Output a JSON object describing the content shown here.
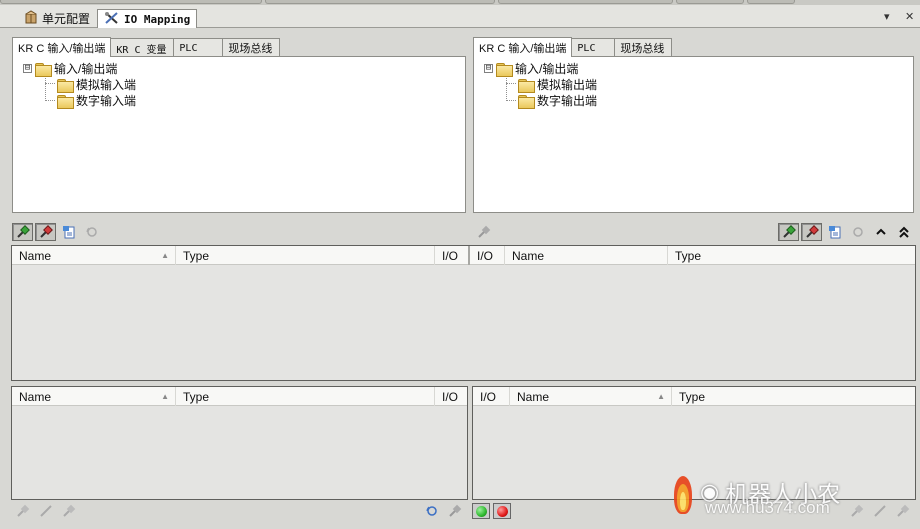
{
  "doc_tabs": [
    {
      "label": "单元配置",
      "icon": "cell-config-icon"
    },
    {
      "label": "IO Mapping",
      "icon": "io-mapping-icon"
    }
  ],
  "window_buttons": {
    "dropdown": "▾",
    "close": "✕"
  },
  "left_panel": {
    "tabs": [
      "KR C 输入/输出端",
      "KR C 变量",
      "PLC",
      "现场总线"
    ],
    "tree": {
      "root": "输入/输出端",
      "children": [
        "模拟输入端",
        "数字输入端"
      ]
    }
  },
  "right_panel": {
    "tabs": [
      "KR C 输入/输出端",
      "PLC",
      "现场总线"
    ],
    "tree": {
      "root": "输入/输出端",
      "children": [
        "模拟输出端",
        "数字输出端"
      ]
    }
  },
  "mapping_grid": {
    "left_columns": [
      "Name",
      "Type",
      "I/O"
    ],
    "right_columns": [
      "I/O",
      "Name",
      "Type"
    ]
  },
  "bottom_left_grid": {
    "columns": [
      "Name",
      "Type",
      "I/O"
    ]
  },
  "bottom_right_grid": {
    "columns": [
      "I/O",
      "Name",
      "Type"
    ]
  },
  "icons": {
    "expander": "⊟",
    "sort_asc": "▲",
    "connect": "🔌",
    "disconnect": "✂",
    "filter": "📋",
    "search": "🔍",
    "collapse_up": "⌃",
    "collapse_up_double": "⌅"
  },
  "watermark": {
    "text": "机器人小农",
    "url_text": "www.hu374.com"
  },
  "colors": {
    "led_green": "#2eb82e",
    "led_red": "#e01818",
    "folder": "#eac85c"
  }
}
